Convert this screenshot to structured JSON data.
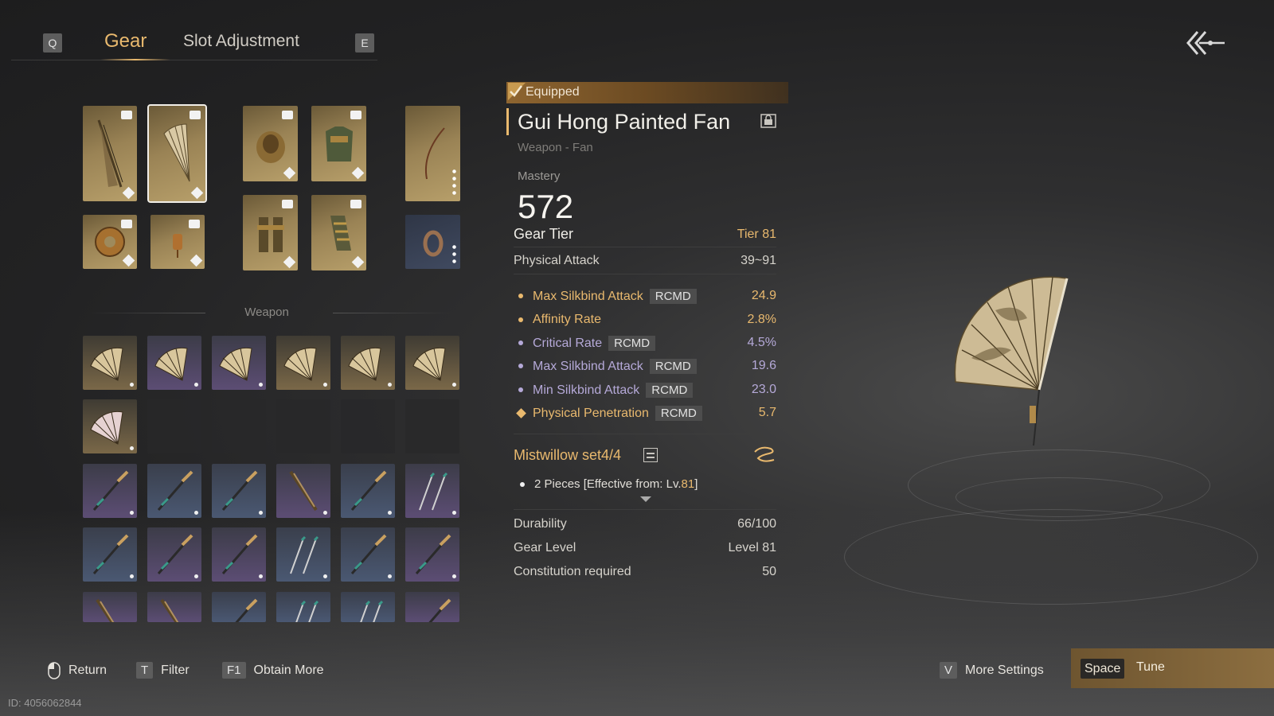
{
  "tabs": {
    "prev_key": "Q",
    "next_key": "E",
    "items": [
      {
        "label": "Gear",
        "active": true
      },
      {
        "label": "Slot Adjustment",
        "active": false
      }
    ]
  },
  "inventory": {
    "section_label": "Weapon"
  },
  "detail": {
    "equipped_label": "Equipped",
    "name": "Gui Hong Painted Fan",
    "type": "Weapon - Fan",
    "mastery_label": "Mastery",
    "mastery_value": "572",
    "gear_tier_label": "Gear Tier",
    "gear_tier_value": "Tier 81",
    "physical_attack_label": "Physical Attack",
    "physical_attack_value": "39~91",
    "substats": [
      {
        "name": "Max Silkbind Attack",
        "tag": "RCMD",
        "value": "24.9",
        "color": "#e9b96e"
      },
      {
        "name": "Affinity Rate",
        "tag": "",
        "value": "2.8%",
        "color": "#e9b96e"
      },
      {
        "name": "Critical Rate",
        "tag": "RCMD",
        "value": "4.5%",
        "color": "#b5a9d8"
      },
      {
        "name": "Max Silkbind Attack",
        "tag": "RCMD",
        "value": "19.6",
        "color": "#b5a9d8"
      },
      {
        "name": "Min Silkbind Attack",
        "tag": "RCMD",
        "value": "23.0",
        "color": "#b5a9d8"
      },
      {
        "name": "Physical Penetration",
        "tag": "RCMD",
        "value": "5.7",
        "color": "#e9b96e"
      }
    ],
    "set_name": "Mistwillow set4/4",
    "set_effect_prefix": "2 Pieces [Effective from: Lv.",
    "set_effect_level": "81",
    "set_effect_suffix": "]",
    "durability_label": "Durability",
    "durability_value": "66/100",
    "gear_level_label": "Gear Level",
    "gear_level_value": "Level 81",
    "constitution_label": "Constitution required",
    "constitution_value": "50"
  },
  "footer": {
    "return_label": "Return",
    "filter_key": "T",
    "filter_label": "Filter",
    "obtain_key": "F1",
    "obtain_label": "Obtain More",
    "more_key": "V",
    "more_label": "More Settings",
    "tune_key": "Space",
    "tune_label": "Tune",
    "id_text": "ID: 4056062844"
  },
  "colors": {
    "accent_gold": "#e9b96e",
    "rare_purple": "#b5a9d8",
    "equipped_bar": "#8e6530"
  }
}
